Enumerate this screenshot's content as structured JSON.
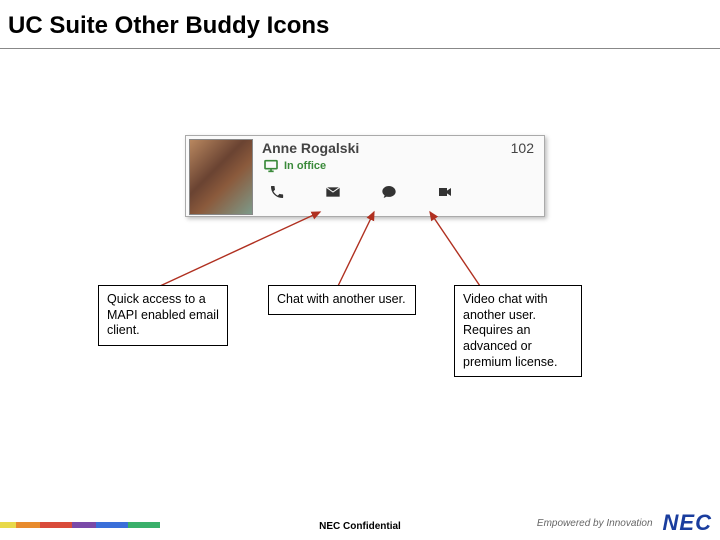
{
  "title": "UC Suite Other Buddy Icons",
  "buddy": {
    "name": "Anne Rogalski",
    "extension": "102",
    "status": "In office",
    "icons": {
      "monitor": "monitor-icon",
      "phone": "phone-icon",
      "mail": "mail-icon",
      "chat": "chat-icon",
      "video": "video-icon"
    }
  },
  "callouts": {
    "mail": "Quick access to a MAPI enabled email client.",
    "chat": "Chat with another user.",
    "video": "Video chat with another user. Requires an advanced or premium license."
  },
  "footer": {
    "confidential": "NEC Confidential",
    "tagline": "Empowered by Innovation",
    "logo": "NEC"
  }
}
